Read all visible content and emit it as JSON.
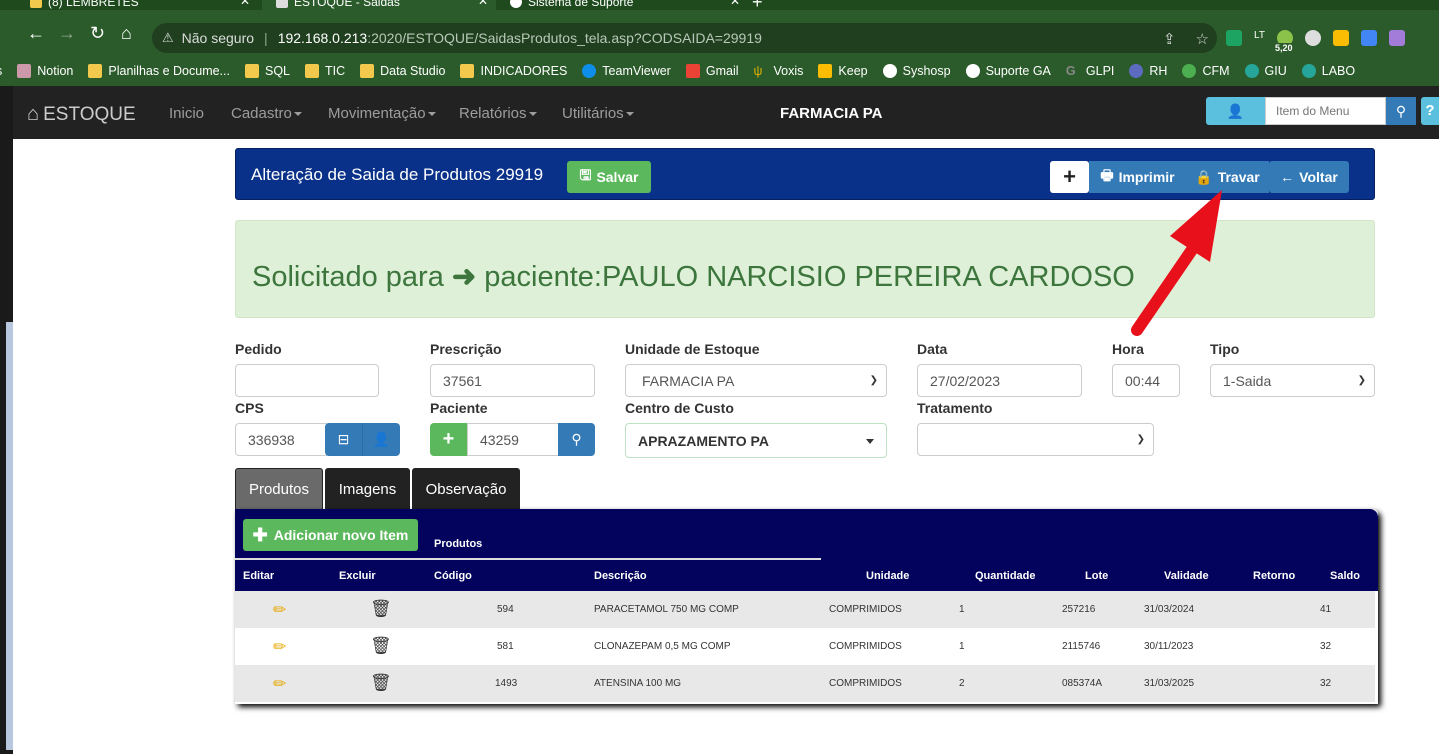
{
  "browser": {
    "tabs": [
      {
        "title": "(8) LEMBRETES"
      },
      {
        "title": "ESTOQUE - Saidas"
      },
      {
        "title": "Sistema de Suporte"
      }
    ],
    "new_tab": "+",
    "security": "Não seguro",
    "url_host": "192.168.0.213",
    "url_rest": ":2020/ESTOQUE/SaidasProdutos_tela.asp?CODSAIDA=29919",
    "ext_badge": "5,20",
    "bookmarks": [
      "Notion",
      "Planilhas e Docume...",
      "SQL",
      "TIC",
      "Data Studio",
      "INDICADORES",
      "TeamViewer",
      "Gmail",
      "Voxis",
      "Keep",
      "Syshosp",
      "Suporte GA",
      "GLPI",
      "RH",
      "CFM",
      "GIU",
      "LABO"
    ]
  },
  "nav": {
    "brand": "ESTOQUE",
    "items": [
      "Inicio",
      "Cadastro",
      "Movimentação",
      "Relatórios",
      "Utilitários"
    ],
    "center_title": "FARMACIA PA",
    "search_placeholder": "Item do Menu",
    "help": "?"
  },
  "header": {
    "title": "Alteração de Saida de Produtos 29919",
    "save_label": "Salvar",
    "add_label": "+",
    "print_label": "Imprimir",
    "lock_label": "Travar",
    "back_label": "Voltar"
  },
  "alert": {
    "prefix": "Solicitado para",
    "text": "paciente:PAULO NARCISIO PEREIRA CARDOSO"
  },
  "form": {
    "pedido": {
      "label": "Pedido",
      "value": ""
    },
    "prescricao": {
      "label": "Prescrição",
      "value": "37561"
    },
    "unidade": {
      "label": "Unidade de Estoque",
      "value": "FARMACIA PA"
    },
    "data": {
      "label": "Data",
      "value": "27/02/2023"
    },
    "hora": {
      "label": "Hora",
      "value": "00:44"
    },
    "tipo": {
      "label": "Tipo",
      "value": "1-Saida"
    },
    "cps": {
      "label": "CPS",
      "value": "336938"
    },
    "paciente": {
      "label": "Paciente",
      "value": "43259"
    },
    "centro": {
      "label": "Centro de Custo",
      "value": "APRAZAMENTO PA"
    },
    "tratamento": {
      "label": "Tratamento",
      "value": ""
    }
  },
  "tabs": [
    "Produtos",
    "Imagens",
    "Observação"
  ],
  "products": {
    "add_label": "Adicionar novo Item",
    "section_label": "Produtos",
    "columns": [
      "Editar",
      "Excluir",
      "Código",
      "Descrição",
      "Unidade",
      "Quantidade",
      "Lote",
      "Validade",
      "Retorno",
      "Saldo"
    ],
    "rows": [
      {
        "codigo": "594",
        "descricao": "PARACETAMOL 750 MG COMP",
        "unidade": "COMPRIMIDOS",
        "quantidade": "1",
        "lote": "257216",
        "validade": "31/03/2024",
        "retorno": "",
        "saldo": "41"
      },
      {
        "codigo": "581",
        "descricao": "CLONAZEPAM 0,5 MG COMP",
        "unidade": "COMPRIMIDOS",
        "quantidade": "1",
        "lote": "2115746",
        "validade": "30/11/2023",
        "retorno": "",
        "saldo": "32"
      },
      {
        "codigo": "1493",
        "descricao": "ATENSINA 100 MG",
        "unidade": "COMPRIMIDOS",
        "quantidade": "2",
        "lote": "085374A",
        "validade": "31/03/2025",
        "retorno": "",
        "saldo": "32"
      }
    ]
  },
  "colors": {
    "browser_green": "#2b5b2b",
    "panel_blue": "#0a3189",
    "table_navy": "#03035d",
    "success": "#5cb85c",
    "primary": "#337ab7",
    "info": "#5bc0de",
    "alert_bg": "#dff0d8",
    "alert_text": "#3c763d",
    "annotation_arrow": "#e8101a"
  }
}
